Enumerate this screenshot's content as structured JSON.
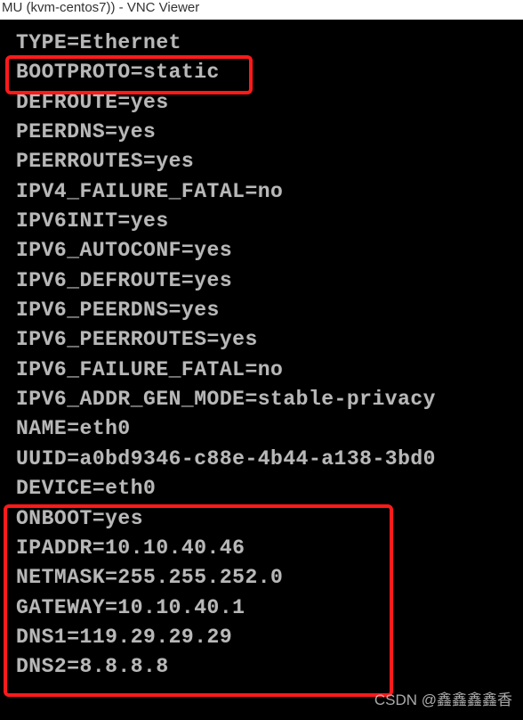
{
  "window": {
    "title": "MU (kvm-centos7)) - VNC Viewer"
  },
  "terminal": {
    "lines": [
      "TYPE=Ethernet",
      "BOOTPROTO=static",
      "DEFROUTE=yes",
      "PEERDNS=yes",
      "PEERROUTES=yes",
      "IPV4_FAILURE_FATAL=no",
      "IPV6INIT=yes",
      "IPV6_AUTOCONF=yes",
      "IPV6_DEFROUTE=yes",
      "IPV6_PEERDNS=yes",
      "IPV6_PEERROUTES=yes",
      "IPV6_FAILURE_FATAL=no",
      "IPV6_ADDR_GEN_MODE=stable-privacy",
      "NAME=eth0",
      "UUID=a0bd9346-c88e-4b44-a138-3bd0",
      "DEVICE=eth0",
      "ONBOOT=yes",
      "IPADDR=10.10.40.46",
      "NETMASK=255.255.252.0",
      "GATEWAY=10.10.40.1",
      "DNS1=119.29.29.29",
      "DNS2=8.8.8.8"
    ]
  },
  "watermark": {
    "text": "CSDN @鑫鑫鑫鑫香"
  }
}
